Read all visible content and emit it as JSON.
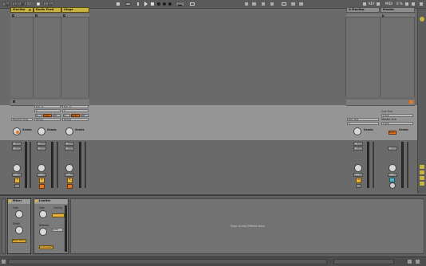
{
  "transport": {
    "tempo_tap": "Tap",
    "tempo": "120.00",
    "time_signature": "4 / 4",
    "loop_mode": "1 Bar",
    "key_label": "KEY",
    "midi_label": "MIDI",
    "cpu": "0 %"
  },
  "tracks": [
    {
      "name": "Monitor"
    },
    {
      "name": "Radio Feed"
    },
    {
      "name": "Stage"
    }
  ],
  "return_track": {
    "name": "A Monitor"
  },
  "master_track": {
    "name": "Master"
  },
  "io": {
    "ext_in": "Ext. In",
    "channel_1": "1",
    "channel_2": "2",
    "in_label": "In",
    "auto_label": "Auto",
    "off_label": "Off",
    "monitor_only": "Monitor Only",
    "group": "Group",
    "ext_out": "Ext. Out",
    "cue_out": "Cue Out",
    "cue_out_channels": "ii 1/2",
    "master_out": "Master Out",
    "master_out_channels": "ii 1/2",
    "post": "Post",
    "sends_label": "Sends",
    "send_a": "A"
  },
  "strips": [
    {
      "track_number": "1",
      "pan": "C",
      "volume": "-inf"
    },
    {
      "track_number": "2",
      "pan": "C",
      "volume": "-inf"
    },
    {
      "track_number": "3",
      "pan": "C",
      "volume": "-inf"
    },
    {
      "track_number": "A",
      "pan": "C",
      "volume": "-inf"
    },
    {
      "track_number": "",
      "pan": "C",
      "volume": "-inf"
    }
  ],
  "devices": {
    "mixer": {
      "title": "Mixer",
      "gain_label": "Gain",
      "width_label": "Width",
      "bass_mono": "Bass Mono"
    },
    "limiter": {
      "title": "Limiter",
      "gain_label": "Gain",
      "ceiling_label": "Ceiling",
      "release_label": "Release",
      "auto_label": "Auto",
      "lookahead": "Lookahead"
    },
    "drop_hint": "Drop Audio Effects Here"
  },
  "colors": {
    "track_header": "#c9b23d",
    "track_button": "#e8b23a",
    "record_button": "#e4781f",
    "master_button": "#4db5c9"
  }
}
